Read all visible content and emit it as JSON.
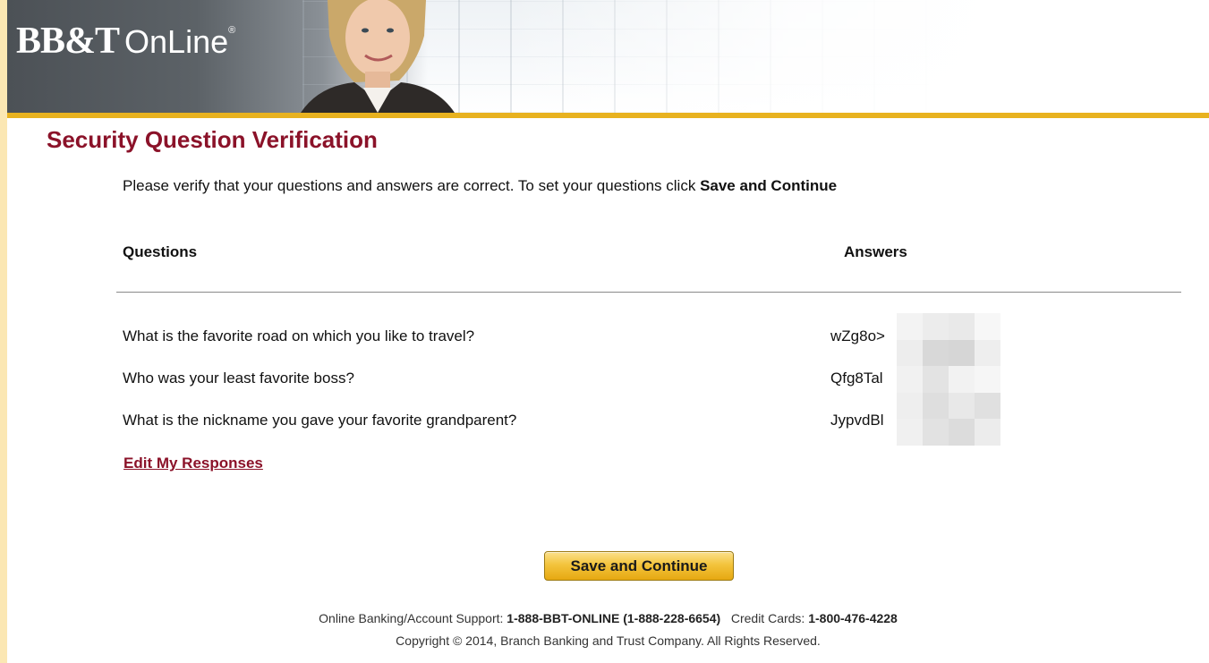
{
  "header": {
    "logo_bbt": "BB&T",
    "logo_online": "OnLine",
    "logo_registered": "®"
  },
  "page": {
    "title": "Security Question Verification",
    "intro_text": "Please verify that your questions and answers are correct. To set your questions click ",
    "intro_bold": "Save and Continue"
  },
  "table": {
    "questions_header": "Questions",
    "answers_header": "Answers",
    "rows": [
      {
        "question": "What is the favorite road on which you like to travel?",
        "answer": "wZg8o>"
      },
      {
        "question": "Who was your least favorite boss?",
        "answer": "Qfg8Tal"
      },
      {
        "question": "What is the nickname you gave your favorite grandparent?",
        "answer": "JypvdBl"
      }
    ]
  },
  "actions": {
    "edit_link": "Edit My Responses",
    "save_button": "Save and Continue"
  },
  "footer": {
    "support_label": "Online Banking/Account Support: ",
    "support_number": "1-888-BBT-ONLINE (1-888-228-6654)",
    "cards_label": "Credit Cards: ",
    "cards_number": "1-800-476-4228",
    "copyright": "Copyright © 2014, Branch Banking and Trust Company. All Rights Reserved."
  },
  "colors": {
    "brand_maroon": "#8b1229",
    "gold": "#e8b21f",
    "page_background": "#fbe7b3"
  }
}
